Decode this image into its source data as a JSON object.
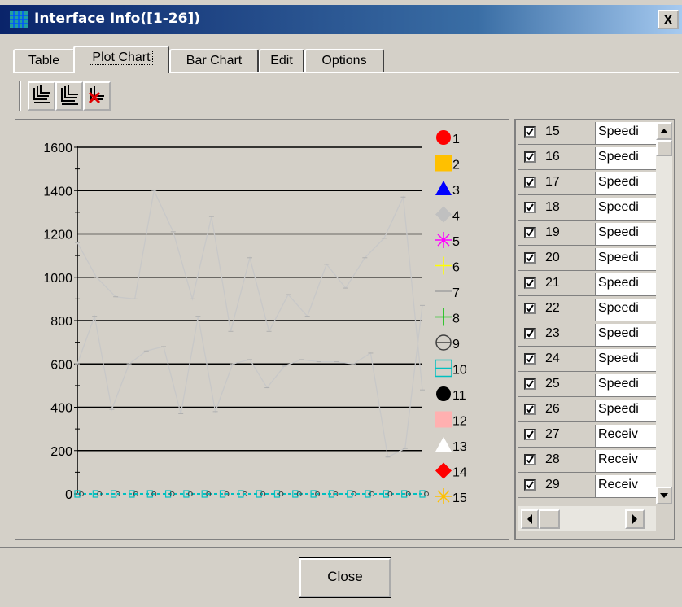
{
  "window": {
    "title": "Interface Info([1-26])",
    "close_glyph": "x"
  },
  "tabs": [
    {
      "label": "Table"
    },
    {
      "label": "Plot Chart"
    },
    {
      "label": "Bar Chart"
    },
    {
      "label": "Edit"
    },
    {
      "label": "Options"
    }
  ],
  "toolbar": {
    "icons": [
      "stack-lines-icon",
      "stack-lines-icon",
      "remove-stack-icon"
    ]
  },
  "chart_data": {
    "type": "line",
    "yticks": [
      0,
      200,
      400,
      600,
      800,
      1000,
      1200,
      1400,
      1600
    ],
    "ylim": [
      0,
      1600
    ],
    "grid": true,
    "points_per_series": 19,
    "series": [
      {
        "name": "7",
        "values": [
          1160,
          1000,
          910,
          900,
          1400,
          1210,
          900,
          1280,
          750,
          1090,
          750,
          920,
          820,
          1060,
          950,
          1090,
          1180,
          1370,
          480
        ]
      },
      {
        "name": "7",
        "values": [
          600,
          820,
          390,
          600,
          660,
          680,
          370,
          820,
          380,
          600,
          620,
          490,
          590,
          620,
          610,
          610,
          600,
          650,
          170,
          210,
          870
        ]
      },
      {
        "name": "10",
        "values": [
          0,
          0,
          0,
          0,
          0,
          0,
          0,
          0,
          0,
          0,
          0,
          0,
          0,
          0,
          0,
          0,
          0,
          0,
          0,
          0
        ]
      }
    ],
    "legend": [
      {
        "label": "1",
        "marker": "circle",
        "color": "#ff0000"
      },
      {
        "label": "2",
        "marker": "square",
        "color": "#ffc000"
      },
      {
        "label": "3",
        "marker": "triangle",
        "color": "#0000ff"
      },
      {
        "label": "4",
        "marker": "diamond",
        "color": "#c0c0c0"
      },
      {
        "label": "5",
        "marker": "asterisk",
        "color": "#ff00ff"
      },
      {
        "label": "6",
        "marker": "plus",
        "color": "#ffff00"
      },
      {
        "label": "7",
        "marker": "dash",
        "color": "#a0a0a0"
      },
      {
        "label": "8",
        "marker": "plus",
        "color": "#00c000"
      },
      {
        "label": "9",
        "marker": "crossed-circle",
        "color": "#404040"
      },
      {
        "label": "10",
        "marker": "crossed-square",
        "color": "#00c0c0"
      },
      {
        "label": "11",
        "marker": "circle",
        "color": "#000000"
      },
      {
        "label": "12",
        "marker": "square",
        "color": "#ffb0b0"
      },
      {
        "label": "13",
        "marker": "triangle",
        "color": "#ffffff"
      },
      {
        "label": "14",
        "marker": "diamond",
        "color": "#ff0000"
      },
      {
        "label": "15",
        "marker": "asterisk",
        "color": "#ffc000"
      }
    ]
  },
  "list": {
    "rows": [
      {
        "num": "15",
        "name": "Speedi",
        "checked": true
      },
      {
        "num": "16",
        "name": "Speedi",
        "checked": true
      },
      {
        "num": "17",
        "name": "Speedi",
        "checked": true
      },
      {
        "num": "18",
        "name": "Speedi",
        "checked": true
      },
      {
        "num": "19",
        "name": "Speedi",
        "checked": true
      },
      {
        "num": "20",
        "name": "Speedi",
        "checked": true
      },
      {
        "num": "21",
        "name": "Speedi",
        "checked": true
      },
      {
        "num": "22",
        "name": "Speedi",
        "checked": true
      },
      {
        "num": "23",
        "name": "Speedi",
        "checked": true
      },
      {
        "num": "24",
        "name": "Speedi",
        "checked": true
      },
      {
        "num": "25",
        "name": "Speedi",
        "checked": true
      },
      {
        "num": "26",
        "name": "Speedi",
        "checked": true
      },
      {
        "num": "27",
        "name": "Receiv",
        "checked": true
      },
      {
        "num": "28",
        "name": "Receiv",
        "checked": true
      },
      {
        "num": "29",
        "name": "Receiv",
        "checked": true
      }
    ]
  },
  "footer": {
    "close_label": "Close"
  }
}
